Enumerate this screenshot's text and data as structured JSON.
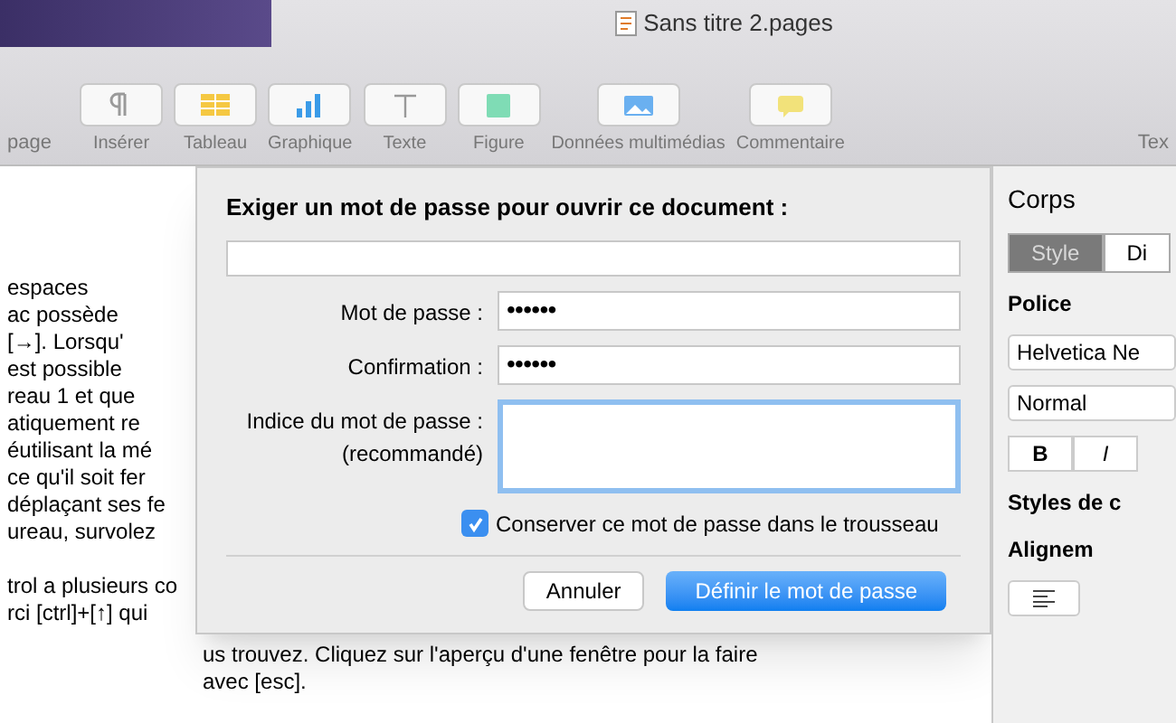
{
  "window": {
    "title": "Sans titre 2.pages"
  },
  "toolbar": {
    "left_label": "page",
    "items": [
      {
        "label": "Insérer",
        "kind": "pilcrow"
      },
      {
        "label": "Tableau",
        "kind": "table"
      },
      {
        "label": "Graphique",
        "kind": "chart"
      },
      {
        "label": "Texte",
        "kind": "text"
      },
      {
        "label": "Figure",
        "kind": "shape"
      },
      {
        "label": "Données multimédias",
        "kind": "media"
      },
      {
        "label": "Commentaire",
        "kind": "comment"
      }
    ],
    "right_label": "Tex"
  },
  "document": {
    "paragraphs": [
      [
        "espaces",
        "ac possède",
        "[→]. Lorsqu'",
        "est possible",
        "reau 1 et que",
        "atiquement re",
        "éutilisant la mé",
        "ce qu'il soit fer",
        "déplaçant ses fe",
        "ureau, survolez"
      ],
      [
        "trol a plusieurs co",
        "rci [ctrl]+[↑] qui"
      ]
    ],
    "bottom_lines": [
      "us trouvez. Cliquez sur l'aperçu d'une fenêtre pour la faire",
      "avec [esc]."
    ]
  },
  "dialog": {
    "heading": "Exiger un mot de passe pour ouvrir ce document :",
    "fields": [
      {
        "kind": "password",
        "label": "Mot de passe :",
        "value": "••••••",
        "focused": false
      },
      {
        "kind": "password",
        "label": "Confirmation :",
        "value": "••••••",
        "focused": false
      },
      {
        "kind": "textarea",
        "label": "Indice du mot de passe :",
        "sublabel": "(recommandé)",
        "focused": true
      }
    ],
    "checkbox": {
      "label": "Conserver ce mot de passe dans le trousseau",
      "checked": true
    },
    "buttons": [
      {
        "label": "Annuler",
        "default": false
      },
      {
        "label": "Définir le mot de passe",
        "default": true
      }
    ]
  },
  "inspector": {
    "heading": "Corps",
    "tabs": [
      {
        "label": "Style",
        "selected": true
      },
      {
        "label": "Di",
        "selected": false
      }
    ],
    "font_section": "Police",
    "font_name": "Helvetica Ne",
    "font_style": "Normal",
    "style_buttons": [
      "B",
      "I"
    ],
    "char_styles": "Styles de c",
    "alignment": "Alignem"
  }
}
